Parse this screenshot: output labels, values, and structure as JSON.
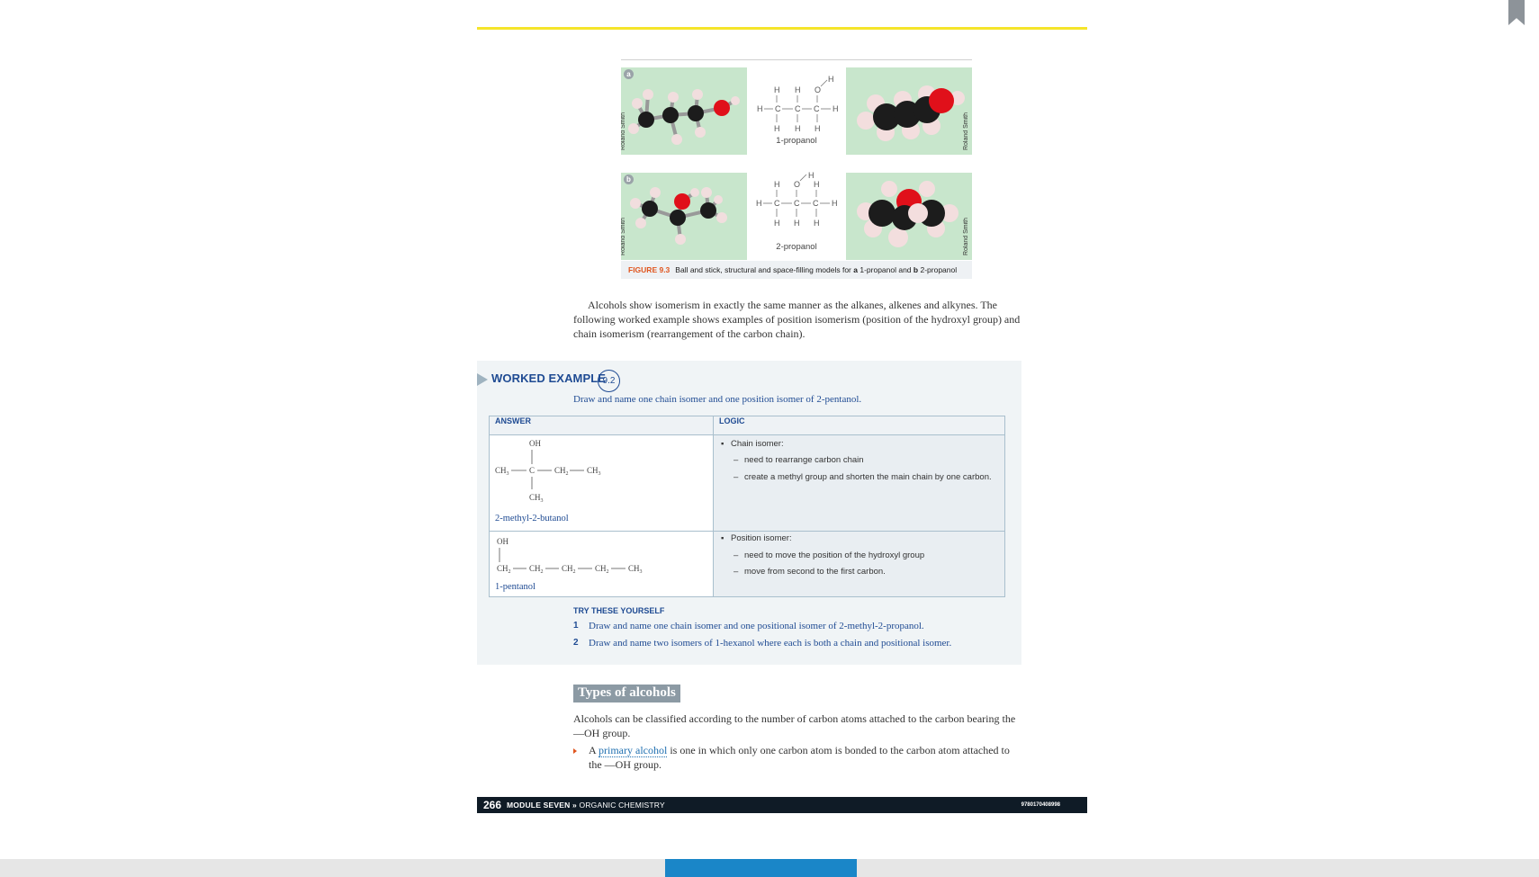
{
  "figure": {
    "label_a": "a",
    "label_b": "b",
    "credit": "Roland Smith",
    "name_a": "1-propanol",
    "name_b": "2-propanol",
    "caption_label": "FIGURE 9.3",
    "caption_pre": "Ball and stick, structural and space-filling models for ",
    "caption_a": "a",
    "caption_mid": " 1-propanol and ",
    "caption_b": "b",
    "caption_post": " 2-propanol"
  },
  "intro_paragraph": "Alcohols show isomerism in exactly the same manner as the alkanes, alkenes and alkynes. The following worked example shows examples of position isomerism (position of the hydroxyl group) and chain isomerism (rearrangement of the carbon chain).",
  "worked_example": {
    "title": "WORKED EXAMPLE",
    "number": "9.2",
    "prompt": "Draw and name one chain isomer and one position isomer of 2-pentanol.",
    "col_answer": "ANSWER",
    "col_logic": "LOGIC",
    "rows": [
      {
        "name": "2-methyl-2-butanol",
        "logic_head": "Chain isomer:",
        "logic_items": [
          "need to rearrange carbon chain",
          "create a methyl group and shorten the main chain by one  carbon."
        ]
      },
      {
        "name": "1-pentanol",
        "logic_head": "Position isomer:",
        "logic_items": [
          "need to move the position of the hydroxyl group",
          "move from second to the first carbon."
        ]
      }
    ],
    "try_title": "TRY THESE YOURSELF",
    "try_items": [
      {
        "num": "1",
        "text": "Draw and name one chain isomer and one positional isomer of 2-methyl-2-propanol."
      },
      {
        "num": "2",
        "text": "Draw and name two isomers of 1-hexanol where each is both a chain and positional isomer."
      }
    ]
  },
  "types_heading": "Types of alcohols",
  "types_paragraph": "Alcohols can be classified according to the number of carbon atoms attached to the carbon bearing the —OH group.",
  "bullet": {
    "pre": "A ",
    "link": "primary alcohol",
    "post": " is one in which only one carbon atom is bonded to the carbon atom attached to the —OH group."
  },
  "footer": {
    "page": "266",
    "module": "MODULE SEVEN",
    "sep": " » ",
    "chapter": "ORGANIC CHEMISTRY",
    "isbn": "9780170408998"
  },
  "colors": {
    "accent_yellow": "#f5e52a",
    "heading_blue": "#1f4b93",
    "figure_orange": "#e0551e",
    "footer_dark": "#0f1b26",
    "scroll_blue": "#1a86c8"
  }
}
